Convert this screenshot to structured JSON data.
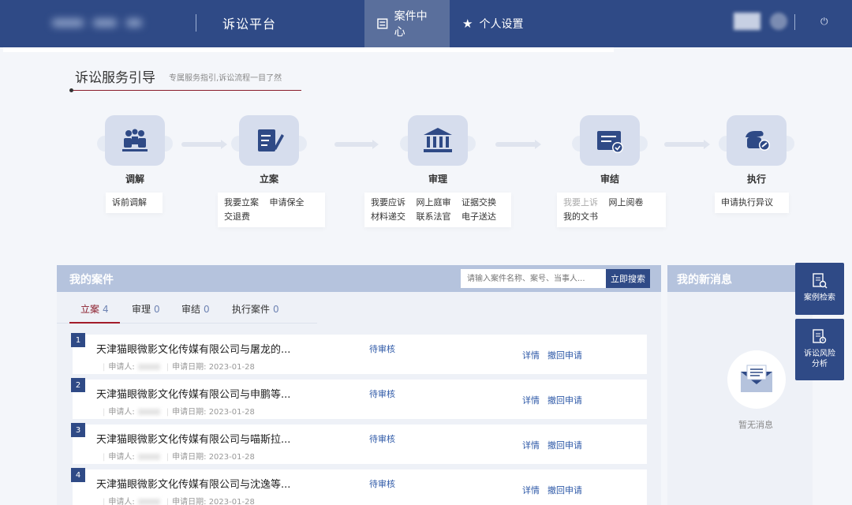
{
  "header": {
    "title": "诉讼平台",
    "nav": [
      {
        "label": "案件中心",
        "icon": "list-icon"
      },
      {
        "label": "个人设置",
        "icon": "star-icon"
      }
    ]
  },
  "guide": {
    "title": "诉讼服务引导",
    "subtitle": "专属服务指引,诉讼流程一目了然",
    "steps": [
      {
        "label": "调解",
        "icon": "mediation-icon",
        "links": [
          "诉前调解"
        ]
      },
      {
        "label": "立案",
        "icon": "file-edit-icon",
        "links": [
          "我要立案",
          "申请保全",
          "交退费"
        ]
      },
      {
        "label": "审理",
        "icon": "courthouse-icon",
        "links": [
          "我要应诉",
          "网上庭审",
          "证据交换",
          "材料递交",
          "联系法官",
          "电子送达"
        ]
      },
      {
        "label": "审结",
        "icon": "verdict-icon",
        "links": [
          "我要上诉",
          "网上阅卷",
          "我的文书"
        ]
      },
      {
        "label": "执行",
        "icon": "gavel-icon",
        "links": [
          "申请执行异议"
        ]
      }
    ]
  },
  "cases": {
    "title": "我的案件",
    "search_placeholder": "请输入案件名称、案号、当事人...",
    "search_button": "立即搜索",
    "tabs": [
      {
        "label": "立案",
        "count": "4"
      },
      {
        "label": "审理",
        "count": "0"
      },
      {
        "label": "审结",
        "count": "0"
      },
      {
        "label": "执行案件",
        "count": "0"
      }
    ],
    "applicant_label": "申请人:",
    "date_label": "申请日期:",
    "rows": [
      {
        "num": "1",
        "name": "天津猫眼微影文化传媒有限公司与屠龙的...",
        "date": "2023-01-28",
        "status": "待审核"
      },
      {
        "num": "2",
        "name": "天津猫眼微影文化传媒有限公司与申鹏等...",
        "date": "2023-01-28",
        "status": "待审核"
      },
      {
        "num": "3",
        "name": "天津猫眼微影文化传媒有限公司与喵斯拉...",
        "date": "2023-01-28",
        "status": "待审核"
      },
      {
        "num": "4",
        "name": "天津猫眼微影文化传媒有限公司与沈逸等...",
        "date": "2023-01-28",
        "status": "待审核"
      }
    ],
    "detail_label": "详情",
    "withdraw_label": "撤回申请"
  },
  "messages": {
    "title": "我的新消息",
    "empty": "暂无消息"
  },
  "side": {
    "case_search": "案例检索",
    "risk_line1": "诉讼风险",
    "risk_line2": "分析"
  },
  "colors": {
    "primary": "#2f4a86",
    "accent": "#a31c2a"
  }
}
